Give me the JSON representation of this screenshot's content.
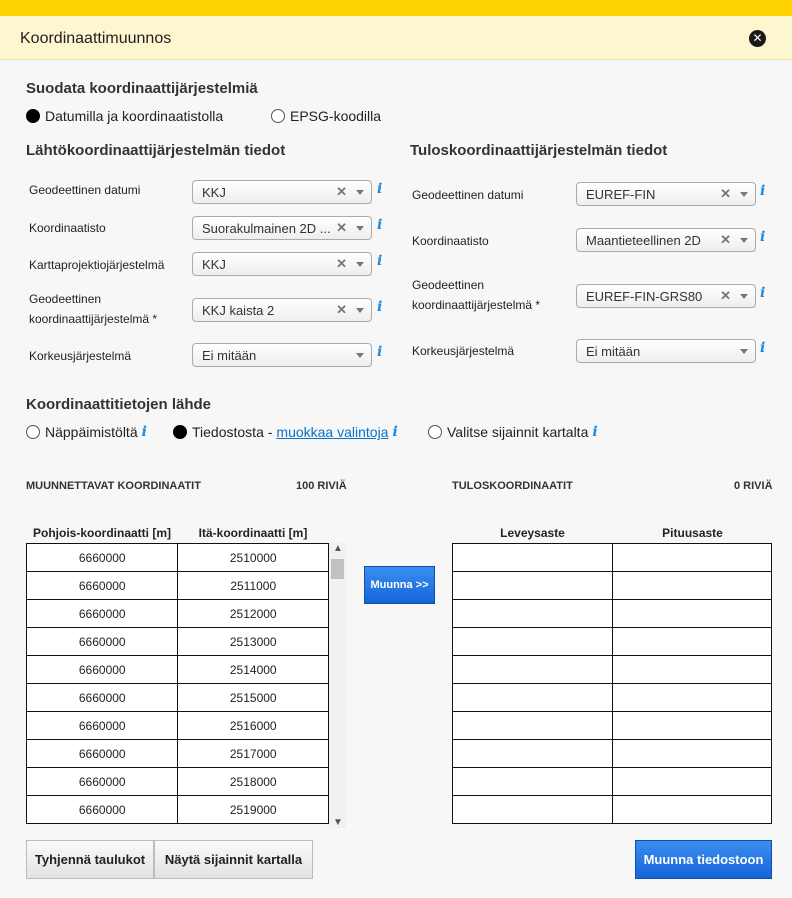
{
  "header": {
    "title": "Koordinaattimuunnos"
  },
  "filter": {
    "heading": "Suodata koordinaattijärjestelmiä",
    "options": [
      {
        "label": "Datumilla ja koordinaatistolla",
        "selected": true
      },
      {
        "label": "EPSG-koodilla",
        "selected": false
      }
    ]
  },
  "source": {
    "heading": "Lähtökoordinaattijärjestelmän tiedot",
    "fields": [
      {
        "label": "Geodeettinen datumi",
        "value": "KKJ",
        "clearable": true
      },
      {
        "label": "Koordinaatisto",
        "value": "Suorakulmainen 2D ...",
        "clearable": true
      },
      {
        "label": "Karttaprojektiojärjestelmä",
        "value": "KKJ",
        "clearable": true
      },
      {
        "label_line1": "Geodeettinen",
        "label_line2": "koordinaattijärjestelmä *",
        "value": "KKJ kaista 2",
        "clearable": true
      },
      {
        "label": "Korkeusjärjestelmä",
        "value": "Ei mitään",
        "clearable": false
      }
    ]
  },
  "target": {
    "heading": "Tuloskoordinaattijärjestelmän tiedot",
    "fields": [
      {
        "label": "Geodeettinen datumi",
        "value": "EUREF-FIN",
        "clearable": true
      },
      {
        "label": "Koordinaatisto",
        "value": "Maantieteellinen 2D",
        "clearable": true
      },
      {
        "label_line1": "Geodeettinen",
        "label_line2": "koordinaattijärjestelmä *",
        "value": "EUREF-FIN-GRS80",
        "clearable": true
      },
      {
        "label": "Korkeusjärjestelmä",
        "value": "Ei mitään",
        "clearable": false
      }
    ]
  },
  "datasource": {
    "heading": "Koordinaattitietojen lähde",
    "options": [
      {
        "label": "Näppäimistöltä",
        "selected": false
      },
      {
        "label": "Tiedostosta - ",
        "link": "muokkaa valintoja",
        "selected": true
      },
      {
        "label": "Valitse sijainnit kartalta",
        "selected": false
      }
    ]
  },
  "icons": {
    "info": "i",
    "clear": "✕",
    "close": "✕",
    "scroll_up": "▲",
    "scroll_down": "▼"
  },
  "input_table": {
    "caption": "MUUNNETTAVAT KOORDINAATIT",
    "count": "100 RIVIÄ",
    "headers": [
      "Pohjois-koordinaatti [m]",
      "Itä-koordinaatti [m]"
    ],
    "rows": [
      [
        "6660000",
        "2510000"
      ],
      [
        "6660000",
        "2511000"
      ],
      [
        "6660000",
        "2512000"
      ],
      [
        "6660000",
        "2513000"
      ],
      [
        "6660000",
        "2514000"
      ],
      [
        "6660000",
        "2515000"
      ],
      [
        "6660000",
        "2516000"
      ],
      [
        "6660000",
        "2517000"
      ],
      [
        "6660000",
        "2518000"
      ],
      [
        "6660000",
        "2519000"
      ]
    ]
  },
  "output_table": {
    "caption": "TULOSKOORDINAATIT",
    "count": "0 RIVIÄ",
    "headers": [
      "Leveysaste",
      "Pituusaste"
    ]
  },
  "buttons": {
    "convert": "Muunna >>",
    "clear": "Tyhjennä taulukot",
    "show_map": "Näytä sijainnit kartalla",
    "convert_file": "Muunna tiedostoon"
  }
}
